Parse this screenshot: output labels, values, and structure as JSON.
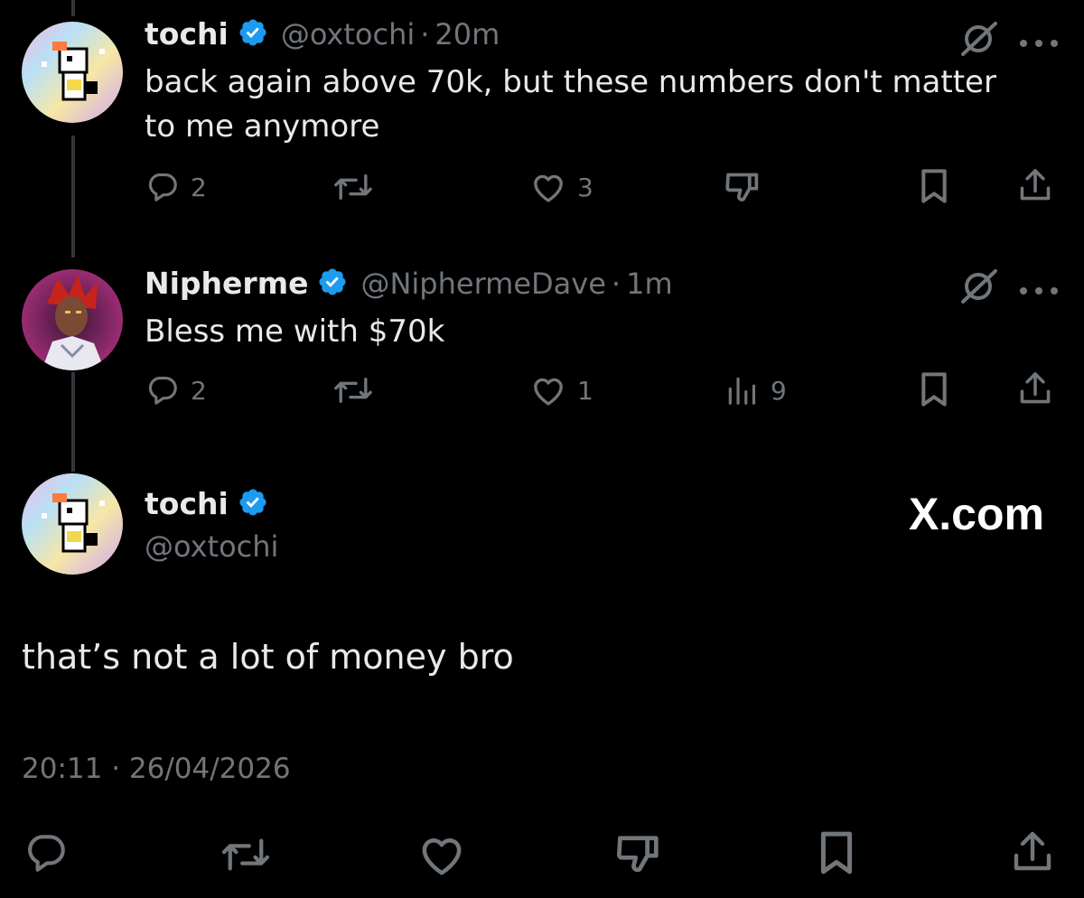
{
  "tweet1": {
    "name": "tochi",
    "handle": "@oxtochi",
    "separator": "·",
    "time": "20m",
    "text": "back again above 70k, but these numbers don't matter to me anymore",
    "replies": "2",
    "likes": "3"
  },
  "tweet2": {
    "name": "Nipherme",
    "handle": "@NiphermeDave",
    "separator": "·",
    "time": "1m",
    "text": "Bless me with $70k",
    "replies": "2",
    "likes": "1",
    "views": "9"
  },
  "main": {
    "name": "tochi",
    "handle": "@oxtochi",
    "watermark": "X.com",
    "text": "that’s not a lot of money bro",
    "timestamp": "20:11 · 26/04/2026"
  },
  "colors": {
    "background": "#000000",
    "text": "#e7e9ea",
    "muted": "#71767b",
    "verified": "#1d9bf0",
    "thread_line": "#333639"
  },
  "icons": [
    "verified-badge-icon",
    "grok-icon",
    "more-icon",
    "reply-icon",
    "retweet-icon",
    "like-icon",
    "dislike-icon",
    "views-icon",
    "bookmark-icon",
    "share-icon"
  ]
}
